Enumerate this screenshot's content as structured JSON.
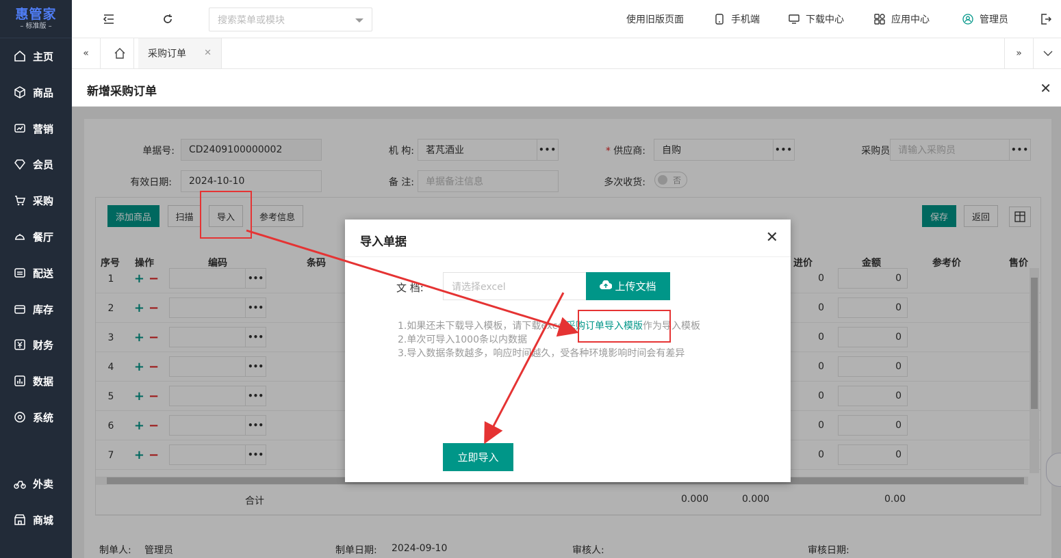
{
  "sidebar": {
    "logo": "惠管家",
    "edition": "标准版",
    "items": [
      {
        "label": "主页",
        "icon": "home-icon"
      },
      {
        "label": "商品",
        "icon": "box-icon"
      },
      {
        "label": "营销",
        "icon": "chart-icon"
      },
      {
        "label": "会员",
        "icon": "diamond-icon"
      },
      {
        "label": "采购",
        "icon": "cart-icon"
      },
      {
        "label": "餐厅",
        "icon": "dish-icon"
      },
      {
        "label": "配送",
        "icon": "truck-icon"
      },
      {
        "label": "库存",
        "icon": "inventory-icon"
      },
      {
        "label": "财务",
        "icon": "yuan-icon"
      },
      {
        "label": "数据",
        "icon": "bar-chart-icon"
      },
      {
        "label": "系统",
        "icon": "settings-icon"
      },
      {
        "label": "外卖",
        "icon": "bike-icon"
      },
      {
        "label": "商城",
        "icon": "store-icon"
      }
    ]
  },
  "topbar": {
    "search_placeholder": "搜索菜单或模块",
    "links": [
      "使用旧版页面",
      "手机端",
      "下载中心",
      "应用中心",
      "管理员"
    ]
  },
  "tabs": {
    "active": "采购订单"
  },
  "page": {
    "title": "新增采购订单"
  },
  "form": {
    "doc_no_label": "单据号:",
    "doc_no": "CD2409100000002",
    "org_label": "机 构:",
    "org": "茗芃酒业",
    "supplier_label": "供应商:",
    "supplier": "自购",
    "buyer_label": "采购员:",
    "buyer_placeholder": "请输入采购员",
    "valid_label": "有效日期:",
    "valid_date": "2024-10-10",
    "remark_label": "备 注:",
    "remark_placeholder": "单据备注信息",
    "multi_label": "多次收货:",
    "multi_value": "否"
  },
  "toolbar": {
    "add": "添加商品",
    "scan": "扫描",
    "import": "导入",
    "ref": "参考信息",
    "save": "保存",
    "back": "返回"
  },
  "table": {
    "headers": [
      "序号",
      "操作",
      "编码",
      "条码",
      "进价",
      "金额",
      "参考价",
      "售价"
    ],
    "rows": [
      {
        "no": "1",
        "price": "0",
        "amount": "0"
      },
      {
        "no": "2",
        "price": "0",
        "amount": "0"
      },
      {
        "no": "3",
        "price": "0",
        "amount": "0"
      },
      {
        "no": "4",
        "price": "0",
        "amount": "0"
      },
      {
        "no": "5",
        "price": "0",
        "amount": "0"
      },
      {
        "no": "6",
        "price": "0",
        "amount": "0"
      },
      {
        "no": "7",
        "price": "0",
        "amount": "0"
      }
    ],
    "total_label": "合计",
    "total_1": "0.000",
    "total_2": "0.000",
    "total_3": "0.00"
  },
  "footer": {
    "maker_label": "制单人:",
    "maker": "管理员",
    "date_label": "制单日期:",
    "date": "2024-09-10",
    "reviewer_label": "审核人:",
    "review_date_label": "审核日期:"
  },
  "dialog": {
    "title": "导入单据",
    "file_label": "文 档:",
    "file_placeholder": "请选择excel",
    "upload": "上传文档",
    "tip1_pre": "1.如果还未下载导入模板，请下载excel",
    "tip1_link": "采购订单导入模版",
    "tip1_post": "作为导入模板",
    "tip2": "2.单次可导入1000条以内数据",
    "tip3": "3.导入数据条数越多，响应时间越久，受各种环境影响时间会有差异",
    "import": "立即导入"
  },
  "colors": {
    "accent": "#009688",
    "sidebar": "#222b38",
    "annotation": "#e53333"
  }
}
